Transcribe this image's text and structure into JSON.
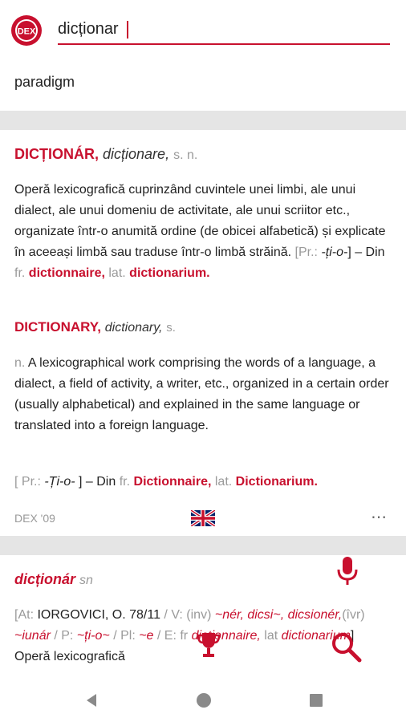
{
  "search": {
    "value": "dicționar",
    "placeholder": ""
  },
  "suggestion": "paradigm",
  "entry1": {
    "headword": "DICȚIONÁR,",
    "plural": "dicționare,",
    "pos": "s. n.",
    "definition": "Operă lexicografică cuprinzând cuvintele unei limbi, ale unui dialect, ale unui domeniu de activitate, ale unui scriitor etc., organizate într-o anumită ordine (de obicei alfabetică) și explicate în aceeași limbă sau traduse într-o limbă străină.",
    "etym_open": "[Pr.: ",
    "etym_pron": "-ți-o-",
    "etym_close": "] – Din ",
    "src_lang1": "fr.",
    "src_word1": "dictionnaire,",
    "src_lang2": "lat.",
    "src_word2": "dictionarium."
  },
  "entry2": {
    "headword": "DICTIONARY,",
    "plural": "dictionary,",
    "pos_s": "s.",
    "pos_n": "n.",
    "definition": "A lexicographical work comprising the words of a language, a dialect, a field of activity, a writer, etc., organized in a certain order (usually alphabetical) and explained in the same language or translated into a foreign language.",
    "etym_open": "[ Pr.: ",
    "etym_pron": "-Ți-o-",
    "etym_close": "] – Din",
    "src_lang1": "fr.",
    "src_word1": "Dictionnaire,",
    "src_lang2": "lat.",
    "src_word2": "Dictionarium."
  },
  "card_footer": {
    "source": "DEX '09",
    "more": "⋯"
  },
  "entry3": {
    "headword": "dicționár",
    "pos": "sn",
    "at_open": "[At: ",
    "at_ref": "IORGOVICI, O. 78/11",
    "sep1": " / V: ",
    "v_inv": "(inv)",
    "v_forms": "~nér, dicsi~,",
    "v_forms2": "dicsionér,",
    "v_ivr": "(îvr)",
    "v_forms3": "~iunár",
    "p_label": " / P: ",
    "p_val": "~ți-o~",
    "pl_label": " / Pl: ",
    "pl_val": "~e",
    "e_label": " / E: fr",
    "e_word1": "dictionnaire,",
    "e_lat": " lat ",
    "e_word2": "dictionarium",
    "e_close": "] ",
    "def_start": "Operă lexicografică"
  },
  "colors": {
    "accent": "#c8102e",
    "separator": "#e5e5e5",
    "muted": "#9a9a9a"
  },
  "icons": {
    "logo": "dex-logo",
    "mic": "microphone-icon",
    "trophy": "trophy-icon",
    "search": "search-icon",
    "back": "nav-back-icon",
    "home": "nav-home-icon",
    "recents": "nav-recents-icon"
  },
  "logo_text": "DEX"
}
